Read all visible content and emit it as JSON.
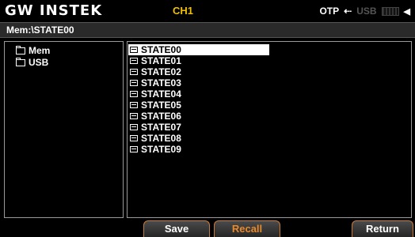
{
  "header": {
    "logo": "GW INSTEK",
    "channel": "CH1",
    "otp": "OTP",
    "usb_indicator": "USB",
    "usb_icon": "usb-icon",
    "battery_icon": "battery-icon",
    "speaker_icon": "speaker-icon",
    "channel_color": "#f0c000"
  },
  "path": "Mem:\\STATE00",
  "tree": {
    "items": [
      {
        "label": "Mem",
        "icon": "folder-icon"
      },
      {
        "label": "USB",
        "icon": "folder-icon"
      }
    ]
  },
  "files": {
    "items": [
      {
        "label": "STATE00",
        "selected": true
      },
      {
        "label": "STATE01"
      },
      {
        "label": "STATE02"
      },
      {
        "label": "STATE03"
      },
      {
        "label": "STATE04"
      },
      {
        "label": "STATE05"
      },
      {
        "label": "STATE06"
      },
      {
        "label": "STATE07"
      },
      {
        "label": "STATE08"
      },
      {
        "label": "STATE09"
      }
    ]
  },
  "softkeys": {
    "save": "Save",
    "recall": "Recall",
    "return": "Return",
    "accent_color": "#e88a2a"
  }
}
